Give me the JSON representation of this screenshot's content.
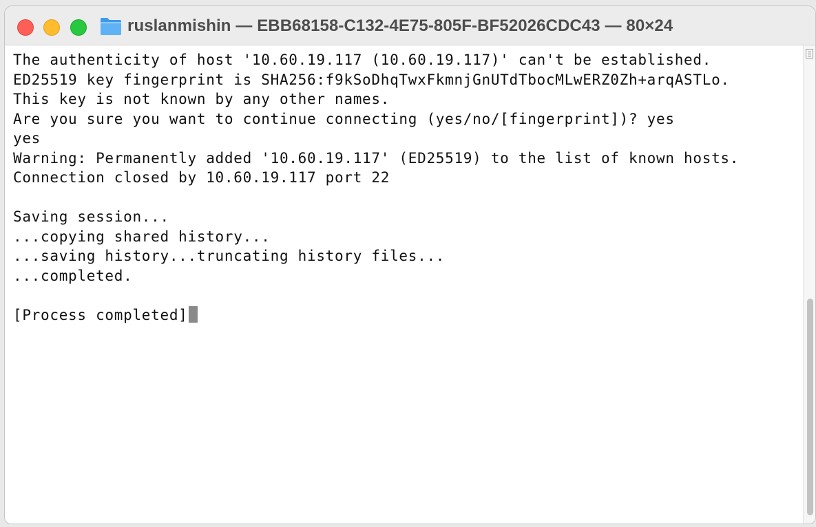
{
  "window": {
    "title": "ruslanmishin — EBB68158-C132-4E75-805F-BF52026CDC43 — 80×24",
    "traffic_lights": {
      "close_color": "#fe5f57",
      "minimize_color": "#febc2e",
      "zoom_color": "#28c840"
    },
    "title_icon": "folder-icon"
  },
  "terminal": {
    "lines": [
      "The authenticity of host '10.60.19.117 (10.60.19.117)' can't be established.",
      "ED25519 key fingerprint is SHA256:f9kSoDhqTwxFkmnjGnUTdTbocMLwERZ0Zh+arqASTLo.",
      "This key is not known by any other names.",
      "Are you sure you want to continue connecting (yes/no/[fingerprint])? yes",
      "yes",
      "Warning: Permanently added '10.60.19.117' (ED25519) to the list of known hosts.",
      "Connection closed by 10.60.19.117 port 22",
      "",
      "Saving session...",
      "...copying shared history...",
      "...saving history...truncating history files...",
      "...completed.",
      "",
      "[Process completed]"
    ],
    "cursor_color": "#8a8a8a"
  }
}
